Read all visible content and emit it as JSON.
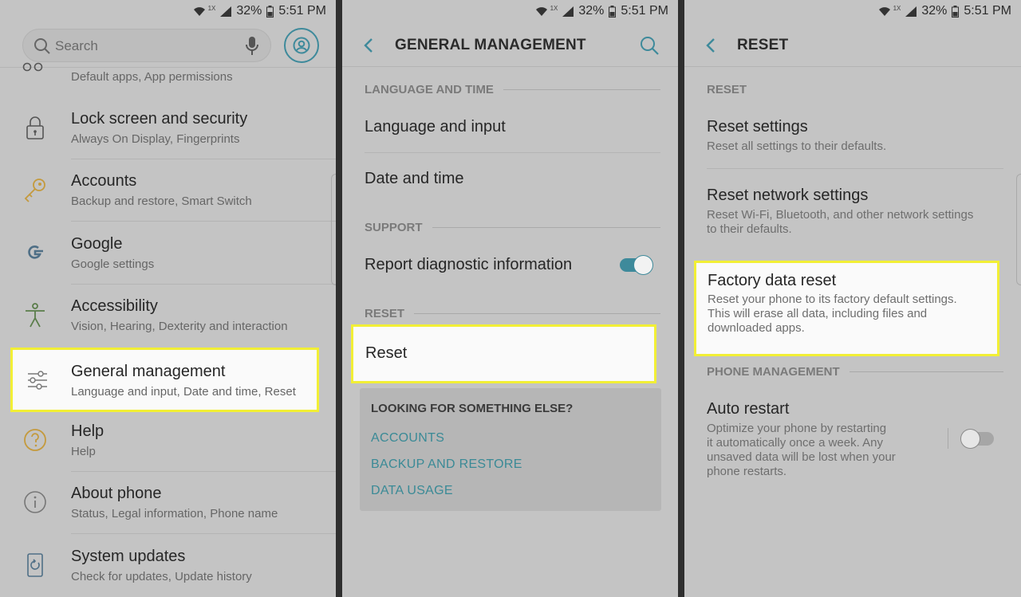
{
  "status_bar": {
    "network": "1X",
    "battery": "32%",
    "time": "5:51 PM"
  },
  "settings": {
    "search_placeholder": "Search",
    "items": [
      {
        "title": "",
        "subtitle": "Default apps, App permissions"
      },
      {
        "title": "Lock screen and security",
        "subtitle": "Always On Display, Fingerprints"
      },
      {
        "title": "Accounts",
        "subtitle": "Backup and restore, Smart Switch"
      },
      {
        "title": "Google",
        "subtitle": "Google settings"
      },
      {
        "title": "Accessibility",
        "subtitle": "Vision, Hearing, Dexterity and interaction"
      },
      {
        "title": "General management",
        "subtitle": "Language and input, Date and time, Reset"
      },
      {
        "title": "Help",
        "subtitle": "Help"
      },
      {
        "title": "About phone",
        "subtitle": "Status, Legal information, Phone name"
      },
      {
        "title": "System updates",
        "subtitle": "Check for updates, Update history"
      }
    ]
  },
  "general_management": {
    "title": "GENERAL MANAGEMENT",
    "section_language": "LANGUAGE AND TIME",
    "language_input": "Language and input",
    "date_time": "Date and time",
    "section_support": "SUPPORT",
    "report_diagnostic": "Report diagnostic information",
    "report_diagnostic_enabled": true,
    "section_reset": "RESET",
    "reset": "Reset",
    "looking_for": "LOOKING FOR SOMETHING ELSE?",
    "links": [
      "ACCOUNTS",
      "BACKUP AND RESTORE",
      "DATA USAGE"
    ]
  },
  "reset_screen": {
    "title": "RESET",
    "section_reset": "RESET",
    "reset_settings": {
      "title": "Reset settings",
      "subtitle": "Reset all settings to their defaults."
    },
    "reset_network": {
      "title": "Reset network settings",
      "subtitle_1": "Reset Wi-Fi, Bluetooth, and other network settings",
      "subtitle_2": "to their defaults."
    },
    "factory_reset": {
      "title": "Factory data reset",
      "subtitle_1": "Reset your phone to its factory default settings.",
      "subtitle_2": "This will erase all data, including files and",
      "subtitle_3": "downloaded apps."
    },
    "section_phone_mgmt": "PHONE MANAGEMENT",
    "auto_restart": {
      "title": "Auto restart",
      "subtitle_1": "Optimize your phone by restarting",
      "subtitle_2": "it automatically once a week. Any",
      "subtitle_3": "unsaved data will be lost when your",
      "subtitle_4": "phone restarts.",
      "enabled": false
    }
  },
  "colors": {
    "accent": "#3e8a9b",
    "highlight_border": "#f2ef35",
    "panel_bg": "#c4c4c4"
  },
  "icons": [
    "wifi-icon",
    "signal-icon",
    "battery-icon",
    "search-icon",
    "mic-icon",
    "account-icon",
    "apps-icon",
    "lock-icon",
    "key-icon",
    "google-icon",
    "accessibility-icon",
    "sliders-icon",
    "help-icon",
    "info-icon",
    "system-update-icon",
    "back-arrow-icon"
  ]
}
